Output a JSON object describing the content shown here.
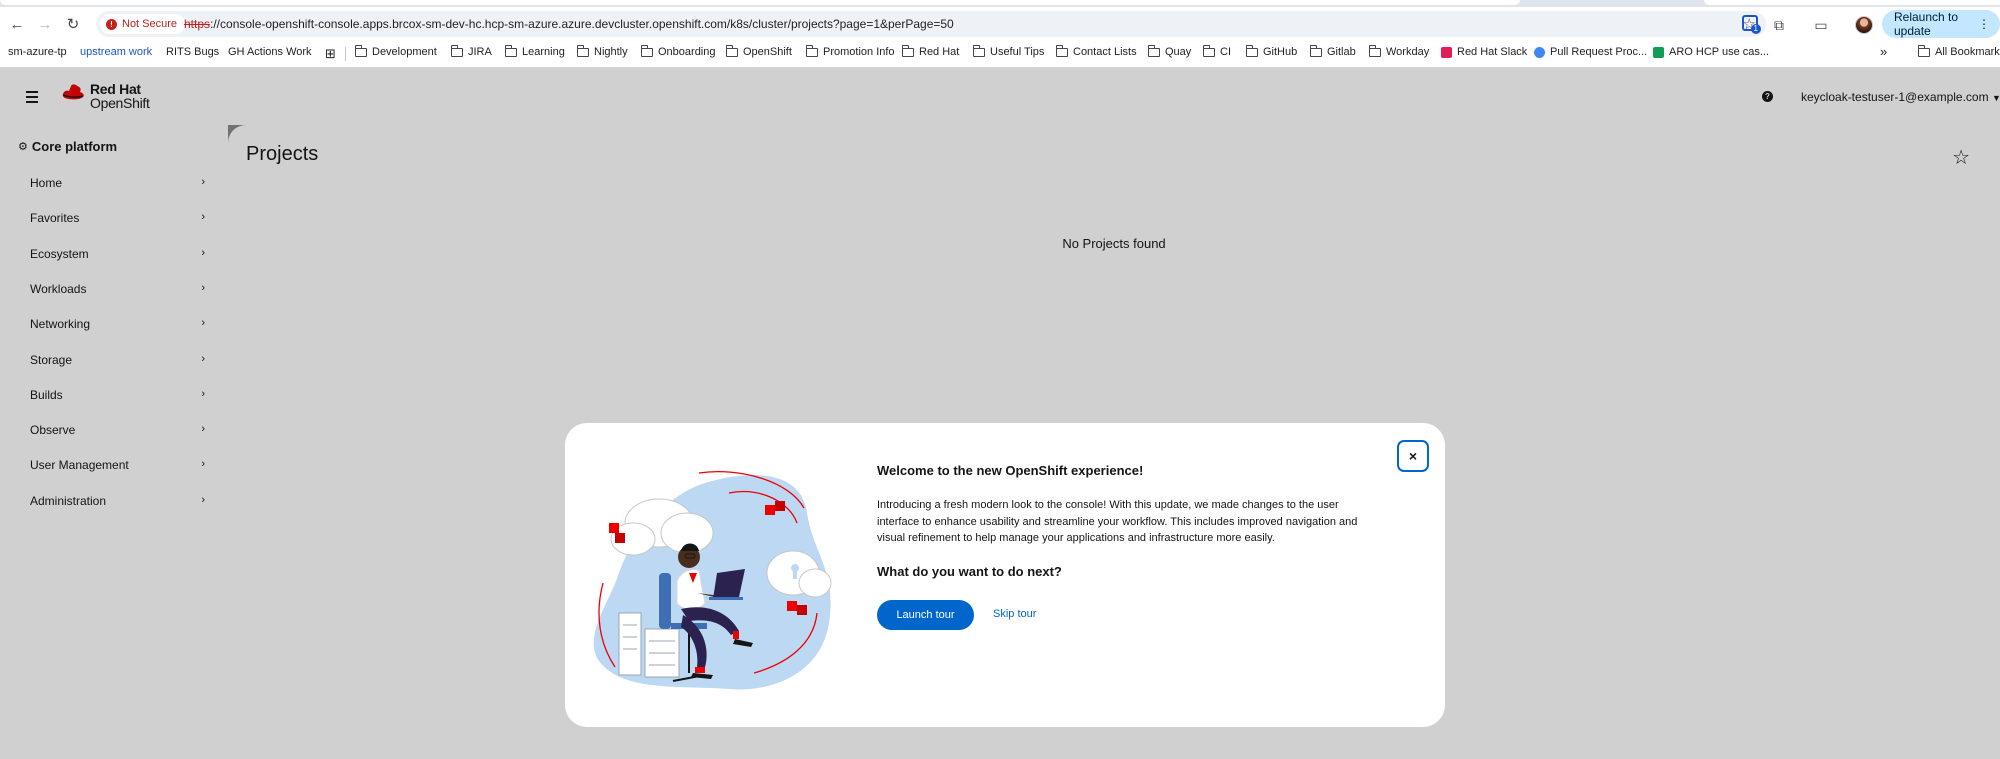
{
  "browser": {
    "security_label": "Not Secure",
    "url_scheme": "https",
    "url_rest": "://console-openshift-console.apps.brcox-sm-dev-hc.hcp-sm-azure.azure.devcluster.openshift.com/k8s/cluster/projects?page=1&perPage=50",
    "extension_badge": "1",
    "relaunch_label": "Relaunch to update",
    "bookmarks": [
      {
        "label": "sm-azure-tp",
        "type": "plain"
      },
      {
        "label": "upstream work",
        "type": "highlight"
      },
      {
        "label": "RITS Bugs",
        "type": "plain"
      },
      {
        "label": "GH Actions Work",
        "type": "plain"
      },
      {
        "label": "Development",
        "type": "folder"
      },
      {
        "label": "JIRA",
        "type": "folder"
      },
      {
        "label": "Learning",
        "type": "folder"
      },
      {
        "label": "Nightly",
        "type": "folder"
      },
      {
        "label": "Onboarding",
        "type": "folder"
      },
      {
        "label": "OpenShift",
        "type": "folder"
      },
      {
        "label": "Promotion Info",
        "type": "folder"
      },
      {
        "label": "Red Hat",
        "type": "folder"
      },
      {
        "label": "Useful Tips",
        "type": "folder"
      },
      {
        "label": "Contact Lists",
        "type": "folder"
      },
      {
        "label": "Quay",
        "type": "folder"
      },
      {
        "label": "CI",
        "type": "folder"
      },
      {
        "label": "GitHub",
        "type": "folder"
      },
      {
        "label": "Gitlab",
        "type": "folder"
      },
      {
        "label": "Workday",
        "type": "folder"
      },
      {
        "label": "Red Hat Slack",
        "type": "slack"
      },
      {
        "label": "Pull Request Proc...",
        "type": "circle"
      },
      {
        "label": "ARO HCP use cas...",
        "type": "sheet"
      }
    ],
    "all_bookmarks_label": "All Bookmarks",
    "overflow_label": "»"
  },
  "masthead": {
    "logo_line1": "Red Hat",
    "logo_line2": "OpenShift",
    "help_icon": "?",
    "user": "keycloak-testuser-1@example.com"
  },
  "sidebar": {
    "perspective": "Core platform",
    "items": [
      {
        "label": "Home"
      },
      {
        "label": "Favorites"
      },
      {
        "label": "Ecosystem"
      },
      {
        "label": "Workloads"
      },
      {
        "label": "Networking"
      },
      {
        "label": "Storage"
      },
      {
        "label": "Builds"
      },
      {
        "label": "Observe"
      },
      {
        "label": "User Management"
      },
      {
        "label": "Administration"
      }
    ]
  },
  "main": {
    "title": "Projects",
    "empty_message": "No Projects found"
  },
  "modal": {
    "close_label": "×",
    "title": "Welcome to the new OpenShift experience!",
    "body": "Introducing a fresh modern look to the console! With this update, we made changes to the user interface to enhance usability and streamline your workflow. This includes improved navigation and visual refinement to help manage your applications and infrastructure more easily.",
    "subtitle": "What do you want to do next?",
    "launch_label": "Launch tour",
    "skip_label": "Skip tour"
  },
  "colors": {
    "primary": "#0066cc",
    "redhat_red": "#ee0000",
    "illustration_blue": "#bcd8f2"
  }
}
